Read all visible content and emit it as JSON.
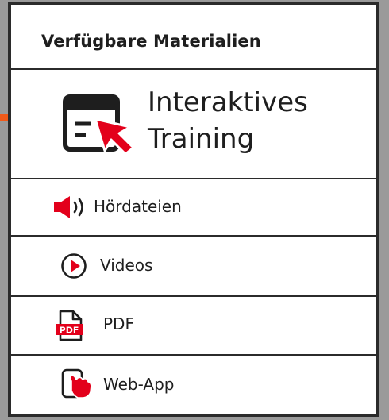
{
  "panel": {
    "title": "Verfügbare Materialien"
  },
  "featured": {
    "label_line1": "Interaktives",
    "label_line2": "Training",
    "icon": "browser-window-cursor-icon"
  },
  "items": [
    {
      "label": "Hördateien",
      "icon": "speaker-icon"
    },
    {
      "label": "Videos",
      "icon": "play-circle-icon"
    },
    {
      "label": "PDF",
      "icon": "pdf-file-icon"
    },
    {
      "label": "Web-App",
      "icon": "tablet-touch-icon"
    }
  ],
  "colors": {
    "accent_red": "#e3001b",
    "arrow_orange": "#f05a1a",
    "border_dark": "#2b2b2b",
    "background_gray": "#9a9a9a"
  }
}
